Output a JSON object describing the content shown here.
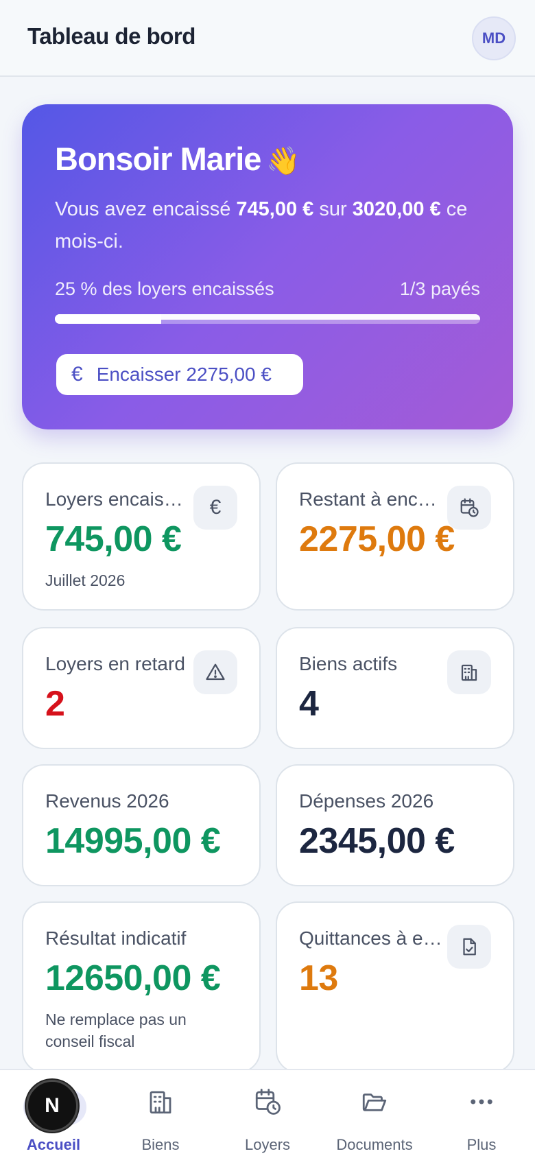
{
  "header": {
    "title": "Tableau de bord",
    "avatar_initials": "MD"
  },
  "hero": {
    "greeting": "Bonsoir Marie",
    "greeting_emoji": "👋",
    "summary_prefix": "Vous avez encaissé ",
    "collected": "745,00 €",
    "summary_mid": " sur ",
    "total": "3020,00 €",
    "summary_suffix": " ce mois-ci.",
    "progress_label": "25 % des loyers encaissés",
    "progress_count": "1/3 payés",
    "progress_fraction": 0.25,
    "cta_icon": "€",
    "cta_label": "Encaisser 2275,00 €"
  },
  "cards": {
    "collected": {
      "label": "Loyers encaissés",
      "value": "745,00 €",
      "sub": "Juillet 2026",
      "icon": "euro-icon"
    },
    "remaining": {
      "label": "Restant à encaisser",
      "value": "2275,00 €",
      "icon": "calendar-clock-icon"
    },
    "late": {
      "label": "Loyers en retard",
      "value": "2",
      "icon": "warning-icon"
    },
    "properties": {
      "label": "Biens actifs",
      "value": "4",
      "icon": "building-icon"
    },
    "revenue": {
      "label": "Revenus 2026",
      "value": "14995,00 €"
    },
    "expenses": {
      "label": "Dépenses 2026",
      "value": "2345,00 €"
    },
    "result": {
      "label": "Résultat indicatif",
      "value": "12650,00 €",
      "sub": "Ne remplace pas un conseil fiscal"
    },
    "receipts": {
      "label": "Quittances à envoyer",
      "value": "13",
      "icon": "document-check-icon"
    }
  },
  "colors": {
    "accent": "#4b4fc4",
    "positive": "#0e9660",
    "warning": "#de7a0e",
    "danger": "#d6111b"
  },
  "nav": {
    "items": [
      {
        "label": "Accueil",
        "icon": "home-icon",
        "active": true
      },
      {
        "label": "Biens",
        "icon": "building-icon"
      },
      {
        "label": "Loyers",
        "icon": "calendar-clock-icon"
      },
      {
        "label": "Documents",
        "icon": "folder-icon"
      },
      {
        "label": "Plus",
        "icon": "more-icon"
      }
    ],
    "badge_letter": "N"
  }
}
